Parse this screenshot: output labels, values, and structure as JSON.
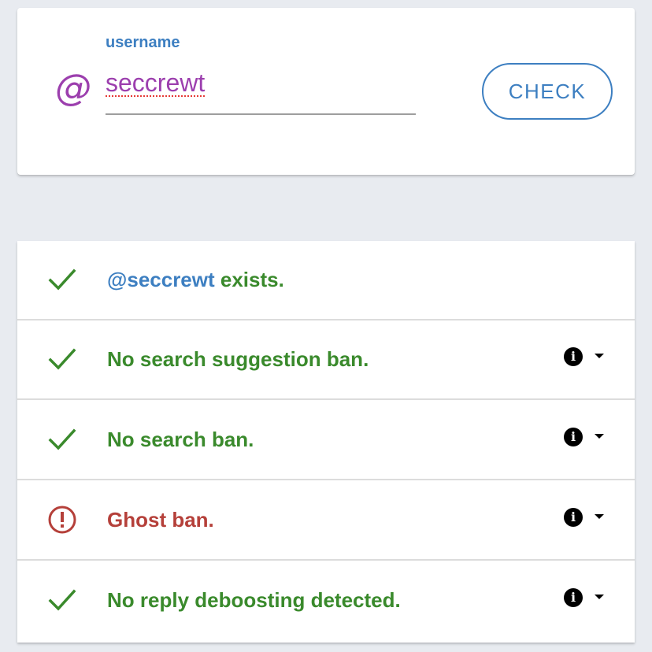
{
  "search": {
    "at_symbol": "@",
    "label": "username",
    "value": "seccrewt",
    "button_label": "CHECK"
  },
  "results": [
    {
      "status": "ok",
      "handle": "@seccrewt",
      "text": " exists.",
      "has_info": false
    },
    {
      "status": "ok",
      "text": "No search suggestion ban.",
      "has_info": true
    },
    {
      "status": "ok",
      "text": "No search ban.",
      "has_info": true
    },
    {
      "status": "warning",
      "text": "Ghost ban.",
      "has_info": true
    },
    {
      "status": "ok",
      "text": "No reply deboosting detected.",
      "has_info": true
    }
  ],
  "icons": {
    "info": "i",
    "ok": "check-icon",
    "warning": "alert-circle-icon",
    "expand": "chevron-down-icon"
  },
  "colors": {
    "ok": "#3a8a2c",
    "warning": "#b5403a",
    "accent": "#3d7fc1",
    "handle": "#9c3fae"
  }
}
